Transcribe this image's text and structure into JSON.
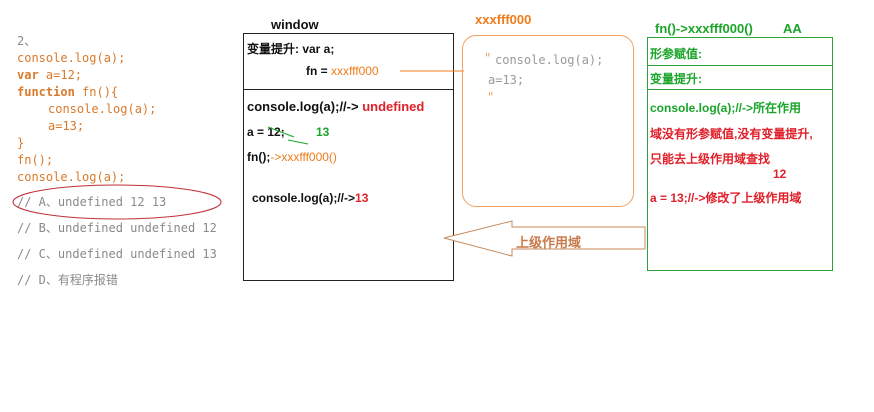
{
  "code": {
    "number": "2、",
    "line1": "console.log(a);",
    "line2_kw": "var",
    "line2_rest": " a=12;",
    "line3_kw": "function",
    "line3_rest": " fn(){",
    "line4": "console.log(a);",
    "line5": "a=13;",
    "line6": "}",
    "line7": "fn();",
    "line8": "console.log(a);",
    "optA": "// A、undefined  12 13",
    "optB": "// B、undefined undefined 12",
    "optC": "// C、undefined undefined 13",
    "optD": "// D、有程序报错"
  },
  "window": {
    "title": "window",
    "hoist": "变量提升: var a;",
    "fn_label": "fn = ",
    "fn_value": "xxxfff000",
    "exec1_prefix": "console.log(a);//-> ",
    "exec1_value": "undefined",
    "exec2_prefix": "a = ",
    "exec2_old": "12;",
    "exec2_new": "13",
    "exec3_prefix": "fn();",
    "exec3_value": "->xxxfff000()",
    "exec4_prefix": "console.log(a);//->",
    "exec4_value": "13"
  },
  "heap": {
    "address": "xxxfff000",
    "quote_open": "\"",
    "line1": "console.log(a);",
    "line2": "a=13;",
    "quote_close": "\""
  },
  "scope": {
    "title": "fn()->xxxfff000()",
    "title_tag": "AA",
    "formal_params": "形参赋值:",
    "hoisting": "变量提升:",
    "explain1": "console.log(a);//->所在作用",
    "explain2": "域没有形参赋值,没有变量提升,",
    "explain3": "只能去上级作用域查找",
    "explain_value": "12",
    "explain4": "a = 13;//->修改了上级作用域"
  },
  "arrow_label": "上级作用域",
  "colors": {
    "orange": "#f07c1a",
    "red": "#e0202a",
    "green": "#1aa52a",
    "arrow_fill": "#c88a5a"
  }
}
